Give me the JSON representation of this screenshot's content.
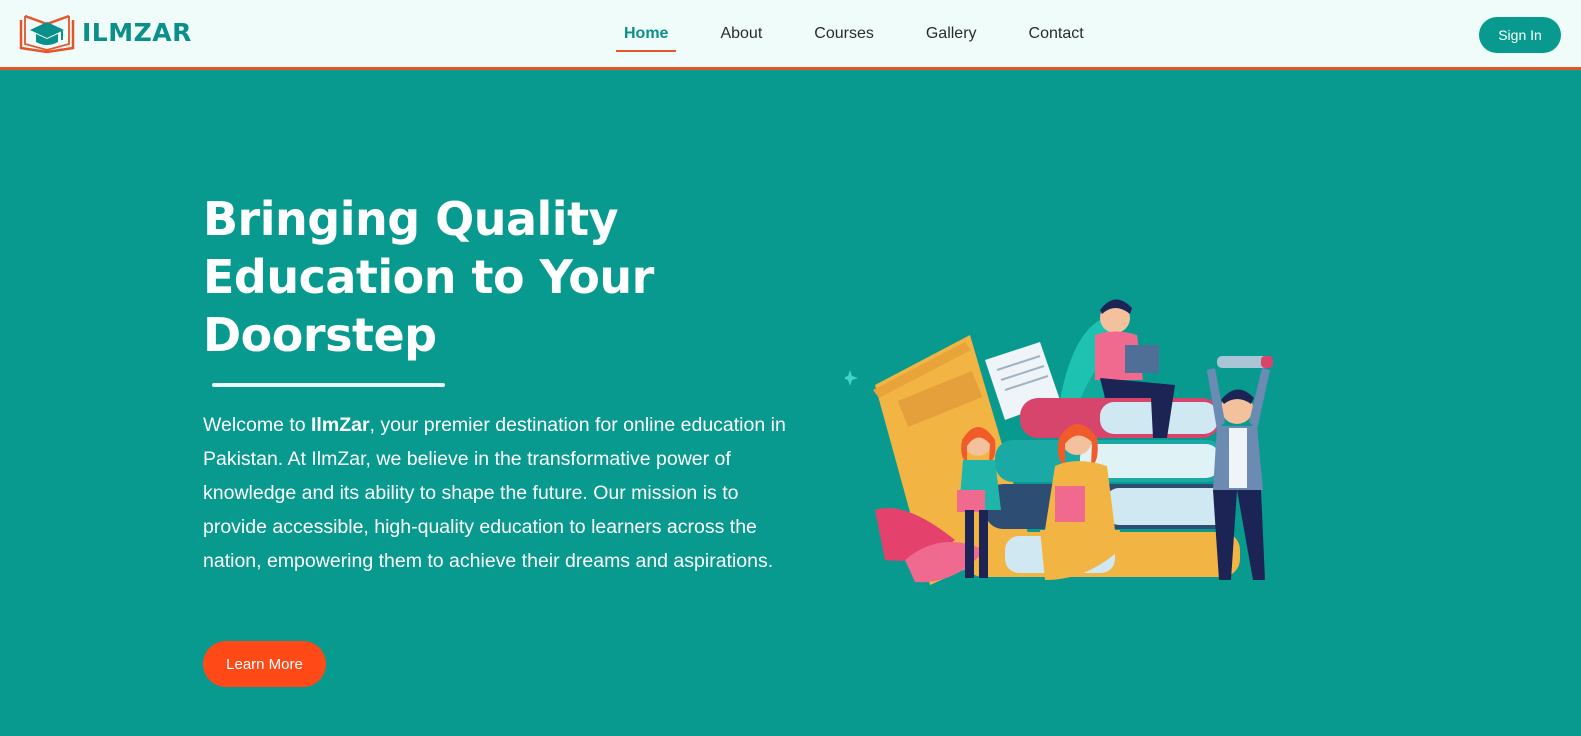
{
  "header": {
    "logo_text": "ILMZAR",
    "nav": [
      {
        "label": "Home",
        "active": true
      },
      {
        "label": "About",
        "active": false
      },
      {
        "label": "Courses",
        "active": false
      },
      {
        "label": "Gallery",
        "active": false
      },
      {
        "label": "Contact",
        "active": false
      }
    ],
    "signin_label": "Sign In"
  },
  "hero": {
    "title_line1": "Bringing Quality",
    "title_line2": "Education to Your",
    "title_line3": "Doorstep",
    "intro_prefix": "Welcome to ",
    "intro_brand": "IlmZar",
    "intro_rest": ", your premier destination for online education in Pakistan. At IlmZar, we believe in the transformative power of knowledge and its ability to shape the future. Our mission is to provide accessible, high-quality education to learners across the nation, empowering them to achieve their dreams and aspirations.",
    "cta_label": "Learn More"
  },
  "colors": {
    "primary": "#089a8f",
    "accent": "#ff4a17",
    "header_bg": "#effcfa",
    "brand_text": "#0b8f8a"
  },
  "icons": {
    "logo": "open-book-graduation-cap-logo",
    "illustration": "students-reading-books-illustration"
  }
}
